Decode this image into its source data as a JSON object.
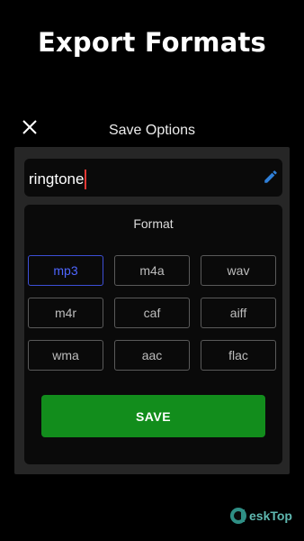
{
  "banner": {
    "title": "Export Formats"
  },
  "dialog": {
    "title": "Save Options",
    "close_icon": "close-icon",
    "filename": "ringtone",
    "edit_icon": "pencil-icon",
    "format_label": "Format",
    "formats": [
      "mp3",
      "m4a",
      "wav",
      "m4r",
      "caf",
      "aiff",
      "wma",
      "aac",
      "flac"
    ],
    "selected_format": "mp3",
    "save_label": "SAVE"
  },
  "watermark": {
    "text": "eskTop"
  },
  "colors": {
    "accent_selected": "#3d4fd6",
    "save_button": "#128d1c",
    "caret": "#e53935",
    "pencil": "#2f7fd8"
  }
}
